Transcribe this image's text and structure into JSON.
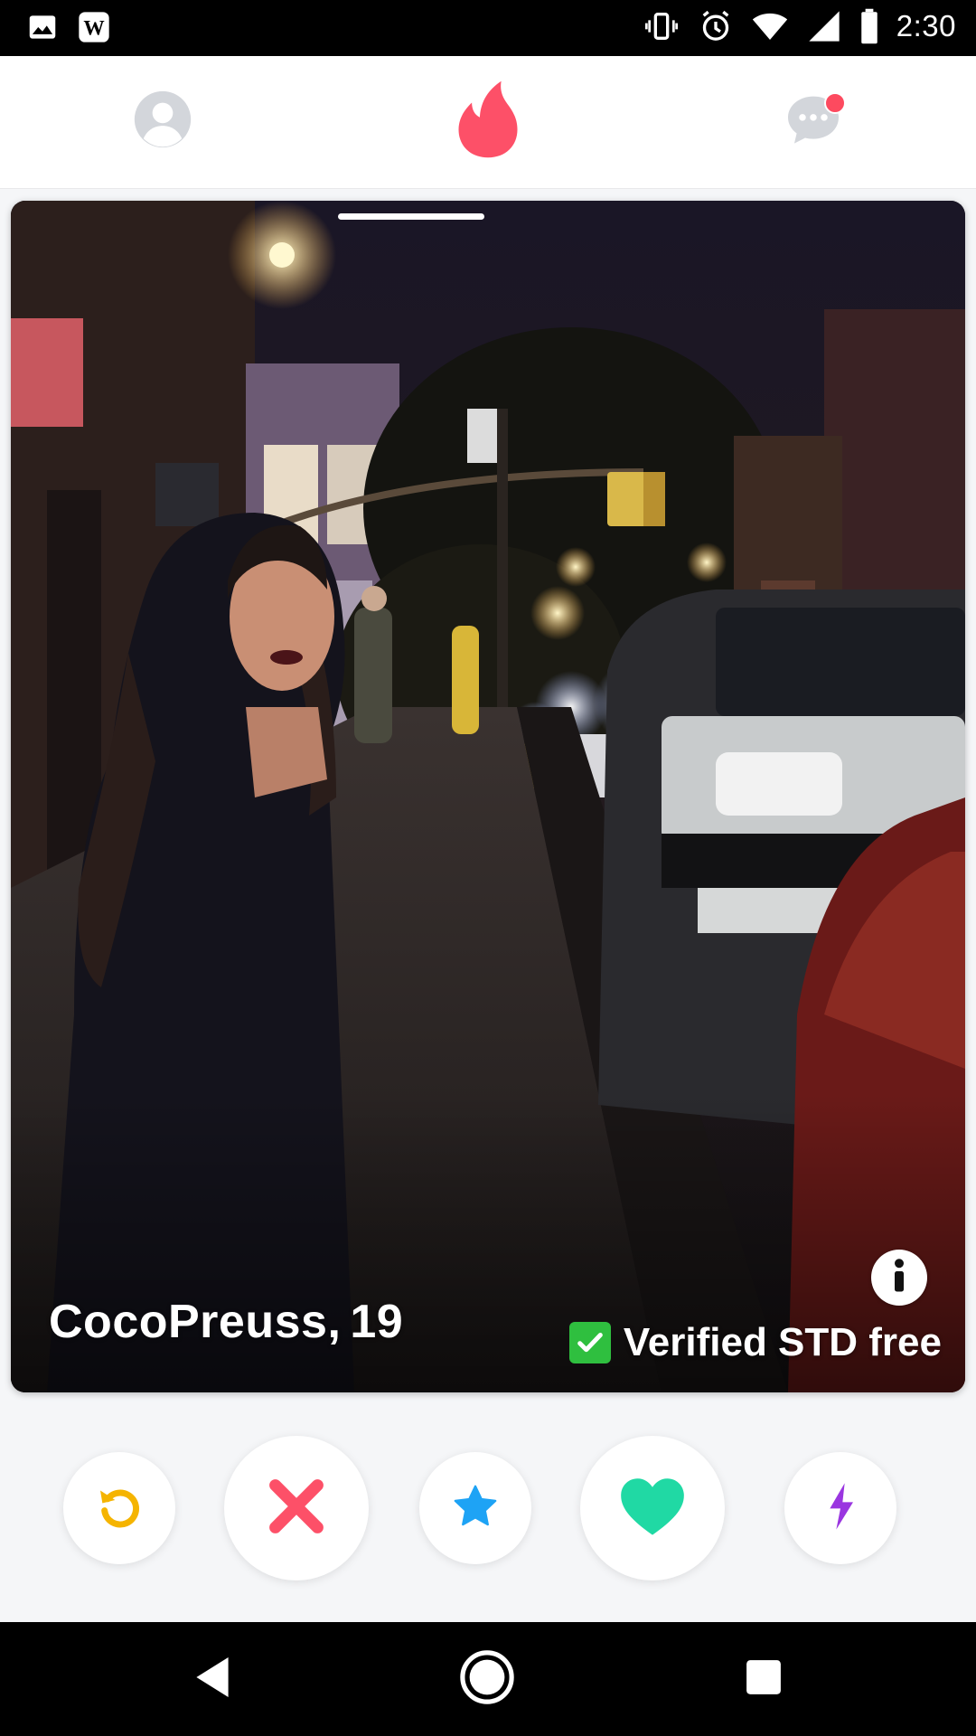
{
  "status_bar": {
    "time": "2:30",
    "left_icons": [
      "image-icon",
      "wikipedia-icon"
    ],
    "right_icons": [
      "vibrate-icon",
      "alarm-icon",
      "wifi-icon",
      "signal-icon",
      "battery-icon"
    ]
  },
  "top_nav": {
    "items": [
      {
        "name": "profile",
        "icon": "person-icon"
      },
      {
        "name": "discover",
        "icon": "flame-icon",
        "active": true
      },
      {
        "name": "messages",
        "icon": "chat-icon",
        "has_notification": true
      }
    ]
  },
  "card": {
    "name": "CocoPreuss,",
    "age": "19",
    "verified_label": "Verified STD free",
    "verified_icon": "check-mark-icon",
    "info_icon": "info-icon",
    "photo": "night street photo of a woman on a city sidewalk"
  },
  "actions": [
    {
      "name": "rewind",
      "icon": "rewind-icon",
      "color": "#f5b400"
    },
    {
      "name": "nope",
      "icon": "close-icon",
      "color": "#fd5068"
    },
    {
      "name": "super-like",
      "icon": "star-icon",
      "color": "#1ea3f5"
    },
    {
      "name": "like",
      "icon": "heart-icon",
      "color": "#20d9a4"
    },
    {
      "name": "boost",
      "icon": "bolt-icon",
      "color": "#9a36e0"
    }
  ],
  "colors": {
    "brand": "#fd5068",
    "nav_inactive": "#d3d6db"
  },
  "system_nav": [
    "back-icon",
    "home-icon",
    "recents-icon"
  ]
}
